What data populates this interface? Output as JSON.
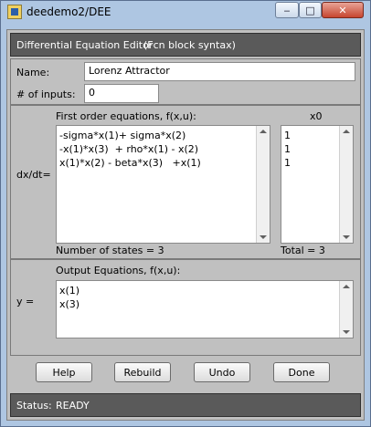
{
  "window": {
    "title": "deedemo2/DEE"
  },
  "banner": {
    "title": "Differential Equation Editor",
    "syntax": "(Fcn block syntax)"
  },
  "form": {
    "name_label": "Name:",
    "name_value": "Lorenz Attractor",
    "inputs_label": "# of inputs:",
    "inputs_value": "0"
  },
  "equations": {
    "header": "First order equations, f(x,u):",
    "x0_header": "x0",
    "row_label": "dx/dt=",
    "lines": "-sigma*x(1)+ sigma*x(2)\n-x(1)*x(3)  + rho*x(1) - x(2)\nx(1)*x(2) - beta*x(3)   +x(1)",
    "x0_values": "1\n1\n1",
    "states_text": "Number of states = 3",
    "total_text": "Total = 3"
  },
  "output": {
    "header": "Output Equations, f(x,u):",
    "row_label": "y =",
    "lines": "x(1)\nx(3)"
  },
  "buttons": {
    "help": "Help",
    "rebuild": "Rebuild",
    "undo": "Undo",
    "done": "Done"
  },
  "status": {
    "label": "Status:",
    "value": "READY"
  }
}
